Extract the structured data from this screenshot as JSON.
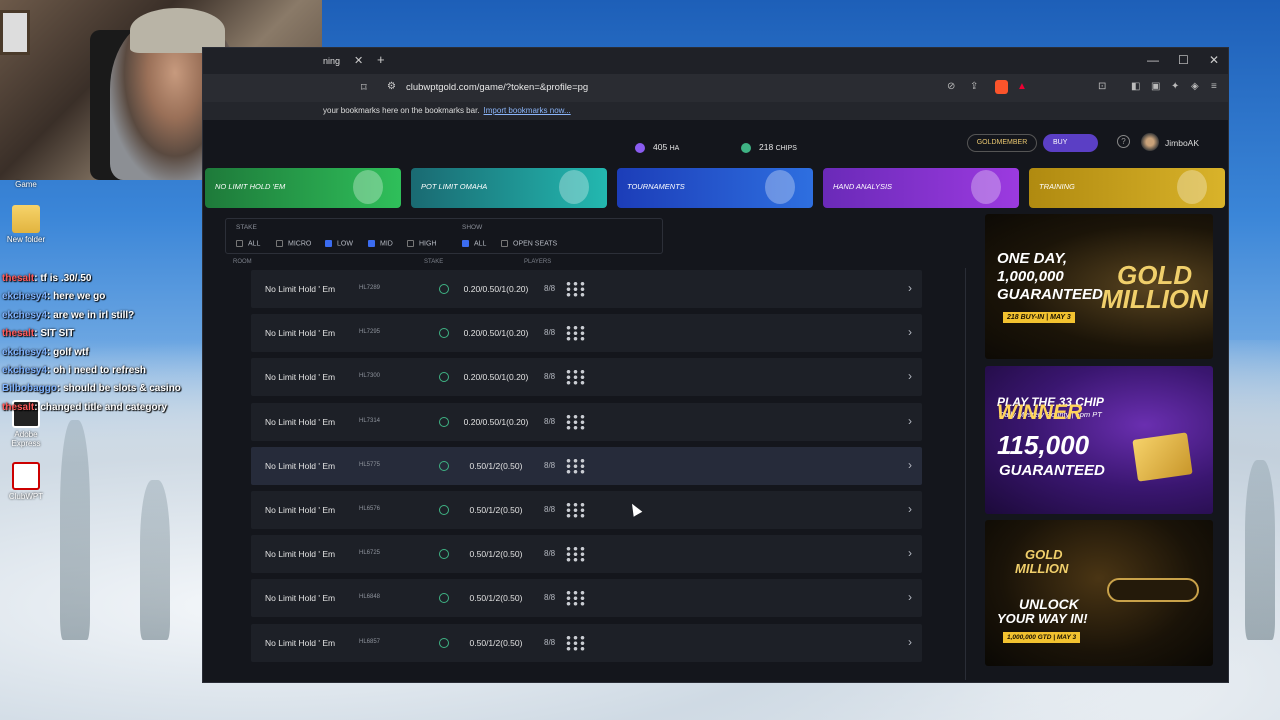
{
  "desktop": {
    "icons": [
      {
        "label": "Game"
      },
      {
        "label": "New folder"
      },
      {
        "label": "Adobe Express"
      },
      {
        "label": "ClubWPT"
      }
    ]
  },
  "chat": [
    {
      "user": "thesalt",
      "msg": ": tf is .30/.50"
    },
    {
      "user": "ekchesy4",
      "msg": ": here we go"
    },
    {
      "user": "ekchesy4",
      "msg": ": are we in irl still?"
    },
    {
      "user": "thesalt",
      "msg": ": SIT SIT"
    },
    {
      "user": "ekchesy4",
      "msg": ": golf wtf"
    },
    {
      "user": "ekchesy4",
      "msg": ": oh i need to refresh"
    },
    {
      "user": "Bilbobaggo",
      "msg": ": should be slots & casino"
    },
    {
      "user": "thesalt",
      "msg": ": changed title and category"
    }
  ],
  "browser": {
    "tab_title": "ning",
    "url": "clubwptgold.com/game/?token=&profile=pg",
    "bookmarks_text": "your bookmarks here on the bookmarks bar.",
    "bookmarks_link": "Import bookmarks now..."
  },
  "header": {
    "ha_value": "405",
    "ha_unit": "HA",
    "chips_value": "218",
    "chips_unit": "CHIPS",
    "gold_label": "GOLDMEMBER",
    "buy_label": "BUY",
    "help_icon": "?",
    "username": "JimboAK"
  },
  "game_tabs": [
    {
      "label": "NO LIMIT HOLD 'EM",
      "color": "#2fbf5a"
    },
    {
      "label": "POT LIMIT OMAHA",
      "color": "#23b8b0"
    },
    {
      "label": "TOURNAMENTS",
      "color": "#2e6fe0"
    },
    {
      "label": "HAND ANALYSIS",
      "color": "#9c3ae0"
    },
    {
      "label": "TRAINING",
      "color": "#d9b32a"
    }
  ],
  "filters": {
    "stake_label": "STAKE",
    "show_label": "SHOW",
    "stake_options": [
      {
        "label": "ALL",
        "checked": false
      },
      {
        "label": "MICRO",
        "checked": false
      },
      {
        "label": "LOW",
        "checked": true
      },
      {
        "label": "MID",
        "checked": true
      },
      {
        "label": "HIGH",
        "checked": false
      }
    ],
    "show_options": [
      {
        "label": "ALL",
        "checked": true
      },
      {
        "label": "OPEN SEATS",
        "checked": false
      }
    ]
  },
  "columns": {
    "room": "ROOM",
    "stake": "STAKE",
    "players": "PLAYERS"
  },
  "tables": [
    {
      "name": "No Limit Hold ' Em",
      "code": "HL7289",
      "stake": "0.20/0.50/1(0.20)",
      "players": "8/8"
    },
    {
      "name": "No Limit Hold ' Em",
      "code": "HL7295",
      "stake": "0.20/0.50/1(0.20)",
      "players": "8/8"
    },
    {
      "name": "No Limit Hold ' Em",
      "code": "HL7300",
      "stake": "0.20/0.50/1(0.20)",
      "players": "8/8"
    },
    {
      "name": "No Limit Hold ' Em",
      "code": "HL7314",
      "stake": "0.20/0.50/1(0.20)",
      "players": "8/8"
    },
    {
      "name": "No Limit Hold ' Em",
      "code": "HL5775",
      "stake": "0.50/1/2(0.50)",
      "players": "8/8"
    },
    {
      "name": "No Limit Hold ' Em",
      "code": "HL6576",
      "stake": "0.50/1/2(0.50)",
      "players": "8/8"
    },
    {
      "name": "No Limit Hold ' Em",
      "code": "HL6725",
      "stake": "0.50/1/2(0.50)",
      "players": "8/8"
    },
    {
      "name": "No Limit Hold ' Em",
      "code": "HL6848",
      "stake": "0.50/1/2(0.50)",
      "players": "8/8"
    },
    {
      "name": "No Limit Hold ' Em",
      "code": "HL6857",
      "stake": "0.50/1/2(0.50)",
      "players": "8/8"
    }
  ],
  "promos": {
    "p1": {
      "line1": "ONE DAY,",
      "line2": "1,000,000",
      "line3": "GUARANTEED",
      "brand1": "GOLD",
      "brand2": "MILLION",
      "tag": "218 BUY-IN | MAY 3"
    },
    "p2": {
      "line1": "PLAY THE 33 CHIP",
      "line2": "Daily Mystery Bounty | 5pm PT",
      "amount": "115,000",
      "line3": "GUARANTEED",
      "brand": "WINNER"
    },
    "p3": {
      "brand1": "GOLD",
      "brand2": "MILLION",
      "line1": "UNLOCK",
      "line2": "YOUR WAY IN!",
      "tag": "1,000,000 GTD | MAY 3"
    }
  }
}
